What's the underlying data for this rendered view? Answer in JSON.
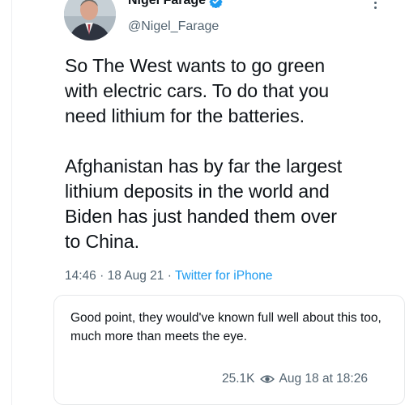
{
  "tweet": {
    "author": {
      "display_name": "Nigel Farage",
      "handle": "@Nigel_Farage",
      "verified_icon": "verified-badge-icon"
    },
    "paragraphs": [
      "So The West wants to go green\nwith electric cars. To do that you\nneed lithium for the batteries.",
      "Afghanistan has by far the largest\nlithium deposits in the world and\nBiden has just handed them over\nto China."
    ],
    "time": "14:46",
    "date": "18 Aug 21",
    "separator": "·",
    "source": "Twitter for iPhone"
  },
  "reply": {
    "text": "Good point, they would've known full well about this too, much more than meets the eye.",
    "views": "25.1K",
    "timestamp": "Aug 18 at 18:26"
  },
  "colors": {
    "text": "#0f1419",
    "muted": "#536471",
    "link": "#1d9bf0",
    "verified": "#1d9bf0"
  }
}
